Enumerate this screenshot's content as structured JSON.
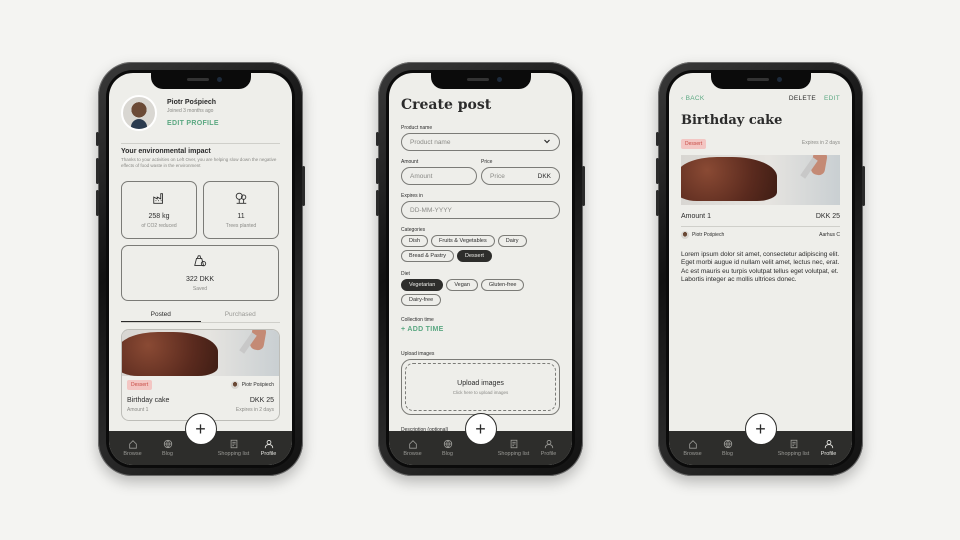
{
  "nav": {
    "items": [
      {
        "label": "Browse",
        "icon": "home-icon"
      },
      {
        "label": "Blog",
        "icon": "globe-icon"
      },
      {
        "label": "Shopping list",
        "icon": "list-icon"
      },
      {
        "label": "Profile",
        "icon": "person-icon"
      }
    ],
    "fab_label": "+"
  },
  "profile": {
    "name": "Piotr Pośpiech",
    "joined": "Joined 3 months ago",
    "edit_label": "EDIT PROFILE",
    "impact_title": "Your environmental impact",
    "impact_desc": "Thanks to your activities on Left Over, you are helping slow down the negative effects of food waste in the environment",
    "stats": [
      {
        "value": "258 kg",
        "label": "of CO2 reduced",
        "icon": "factory-icon"
      },
      {
        "value": "11",
        "label": "Trees planted",
        "icon": "trees-icon"
      },
      {
        "value": "322 DKK",
        "label": "Saved",
        "icon": "money-icon"
      }
    ],
    "tabs": [
      "Posted",
      "Purchased"
    ],
    "card": {
      "tag": "Dessert",
      "seller": "Piotr Pośpiech",
      "title": "Birthday cake",
      "price": "DKK 25",
      "amount": "Amount 1",
      "expires": "Expires in 2 days"
    }
  },
  "create": {
    "title": "Create post",
    "product_label": "Product name",
    "product_placeholder": "Product name",
    "amount_label": "Amount",
    "amount_placeholder": "Amount",
    "price_label": "Price",
    "price_placeholder": "Price",
    "price_suffix": "DKK",
    "expires_label": "Expires in",
    "expires_placeholder": "DD-MM-YYYY",
    "categories_label": "Categories",
    "categories": [
      {
        "label": "Dish",
        "selected": false
      },
      {
        "label": "Fruits & Vegetables",
        "selected": false
      },
      {
        "label": "Dairy",
        "selected": false
      },
      {
        "label": "Bread & Pastry",
        "selected": false
      },
      {
        "label": "Dessert",
        "selected": true
      }
    ],
    "diet_label": "Diet",
    "diets": [
      {
        "label": "Vegetarian",
        "selected": true
      },
      {
        "label": "Vegan",
        "selected": false
      },
      {
        "label": "Gluten-free",
        "selected": false
      },
      {
        "label": "Dairy-free",
        "selected": false
      }
    ],
    "collection_label": "Collection time",
    "add_time_label": "+ ADD TIME",
    "upload_label": "Upload images",
    "upload_title": "Upload images",
    "upload_sub": "Click here to upload images",
    "description_label": "Description (optional)"
  },
  "detail": {
    "back_label": "BACK",
    "delete_label": "DELETE",
    "edit_label": "EDIT",
    "title": "Birthday cake",
    "tag": "Dessert",
    "expires": "Expires in 2 days",
    "amount": "Amount 1",
    "price": "DKK 25",
    "seller": "Piotr Pośpiech",
    "location": "Aarhus C",
    "description": "Lorem ipsum dolor sit amet, consectetur adipiscing elit. Eget morbi augue id nullam velit amet, lectus nec, erat. Ac est mauris eu turpis volutpat tellus eget volutpat, et. Labortis integer ac mollis ultrices donec."
  },
  "colors": {
    "accent": "#5ba882",
    "screen_bg": "#eeeeea",
    "nav_bg": "#2d2d2b",
    "tag_bg": "#f3c6c3",
    "tag_text": "#c74a43"
  }
}
